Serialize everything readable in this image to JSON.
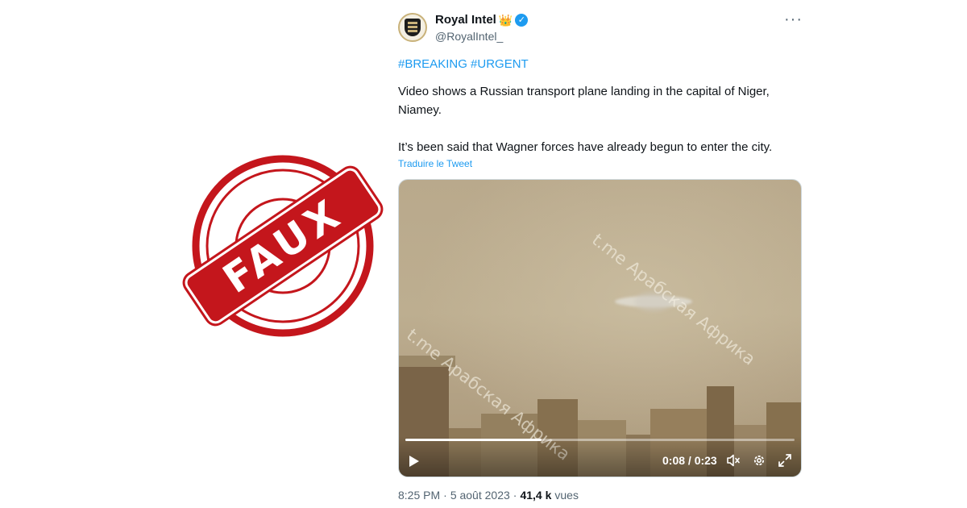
{
  "stamp": {
    "label": "FAUX",
    "color": "#c4161c"
  },
  "tweet": {
    "author_name": "Royal Intel",
    "author_handle": "@RoyalIntel_",
    "name_emoji": "👑",
    "verified": true,
    "more_label": "···",
    "hashtags": [
      "#BREAKING",
      "#URGENT"
    ],
    "paragraphs": [
      "Video shows a Russian transport plane landing in the capital of Niger, Niamey.",
      "It’s been said that Wagner forces have already begun to enter the city."
    ],
    "translate_label": "Traduire le Tweet",
    "video": {
      "watermark": "t.me Арабская Африка",
      "elapsed_label": "0:08 / 0:23",
      "progress_fraction": 0.35,
      "icons": [
        "play-icon",
        "volume-icon",
        "settings-gear-icon",
        "fullscreen-icon"
      ]
    },
    "time": "8:25 PM",
    "separator": "·",
    "date": "5 août 2023",
    "views_count": "41,4 k",
    "views_label": "vues"
  },
  "colors": {
    "link": "#1d9bf0",
    "text": "#0f1419",
    "muted": "#536471"
  }
}
